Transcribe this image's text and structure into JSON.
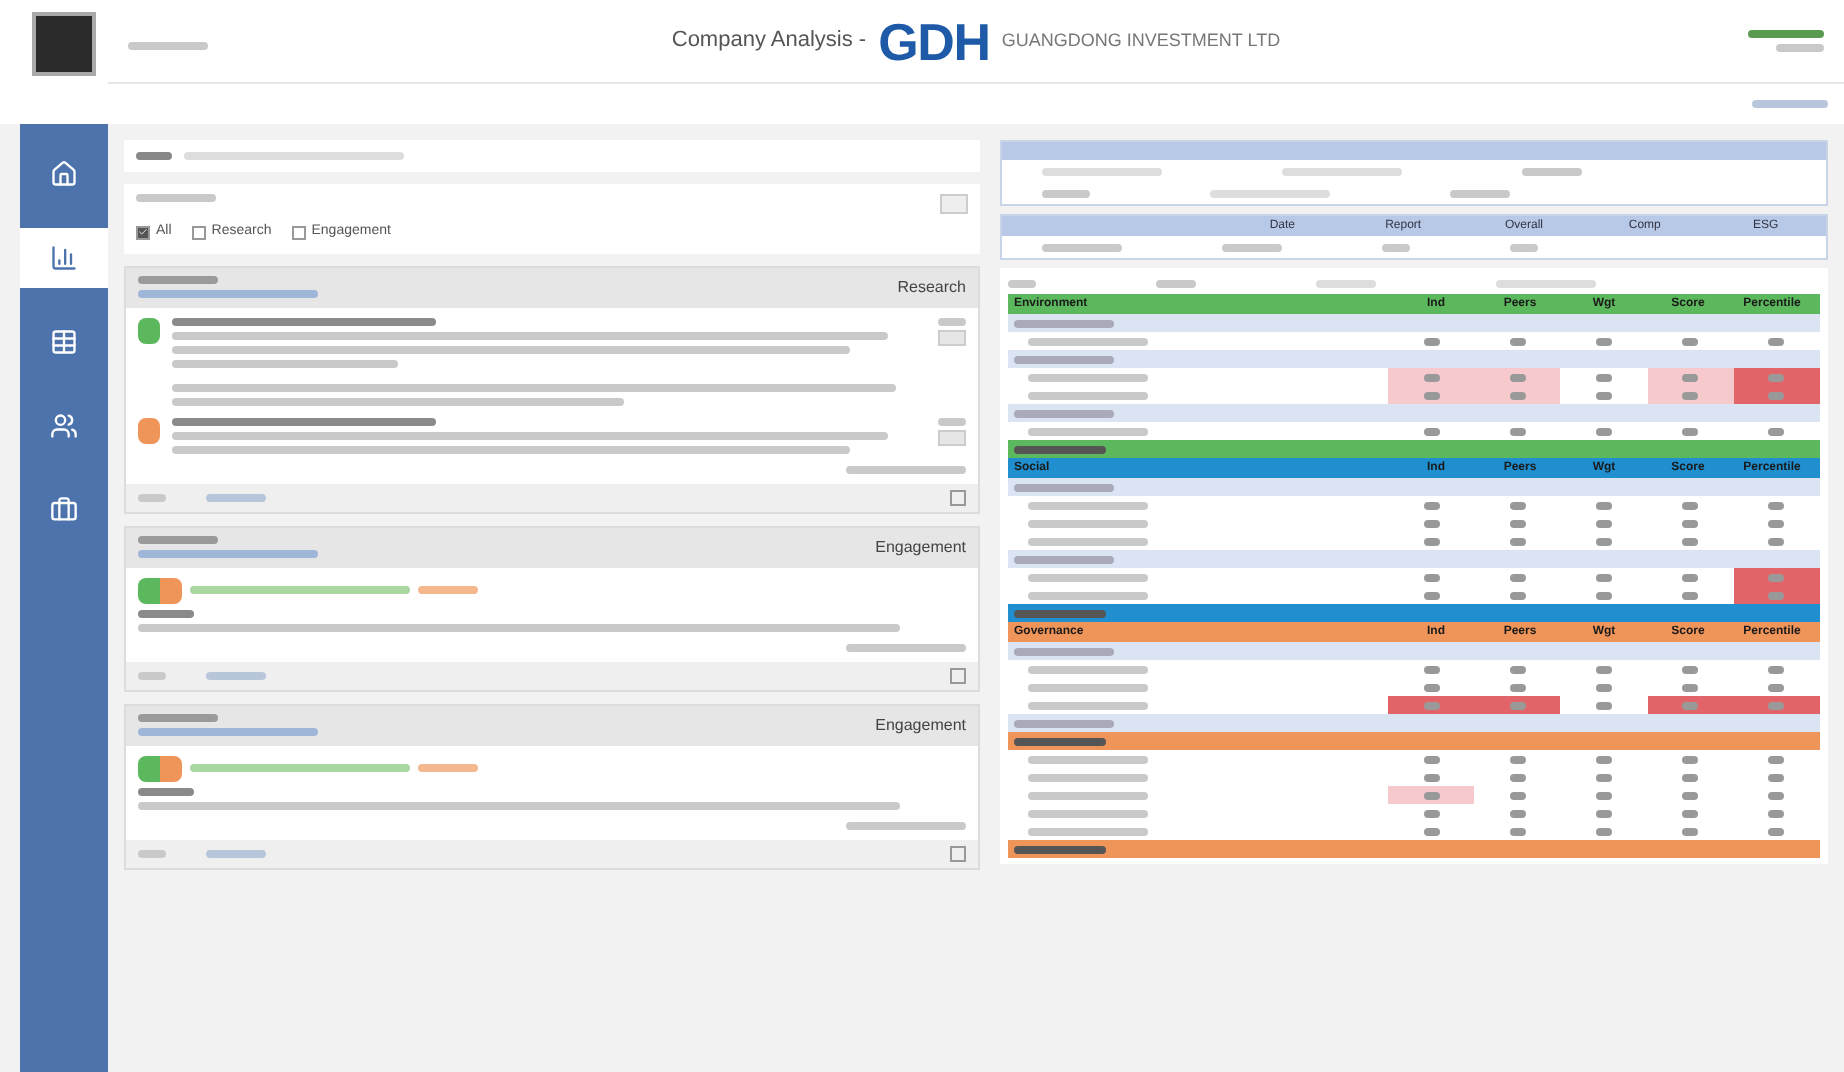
{
  "header": {
    "title": "Company Analysis -",
    "logo": "GDH",
    "company": "GUANGDONG INVESTMENT LTD"
  },
  "sidebar": {
    "items": [
      {
        "kind": "home",
        "selected": false
      },
      {
        "kind": "chart",
        "selected": true
      },
      {
        "kind": "table",
        "selected": false
      },
      {
        "kind": "people",
        "selected": false
      },
      {
        "kind": "briefcase",
        "selected": false
      }
    ]
  },
  "filters": [
    {
      "label": "All",
      "checked": true
    },
    {
      "label": "Research",
      "checked": false
    },
    {
      "label": "Engagement",
      "checked": false
    }
  ],
  "cards": [
    {
      "type": "Research",
      "items": [
        {
          "kind": "note",
          "color": "#5cb85c"
        },
        {
          "kind": "note",
          "color": "#f0955a"
        }
      ]
    },
    {
      "type": "Engagement",
      "items": [
        {
          "kind": "meeting",
          "color": "#5cb85c"
        }
      ]
    },
    {
      "type": "Engagement",
      "items": [
        {
          "kind": "meeting",
          "color": "#5cb85c"
        }
      ]
    }
  ],
  "proxy_table": {
    "columns": [
      "Date",
      "Report",
      "Overall",
      "Comp",
      "ESG"
    ]
  },
  "esg_sections": [
    {
      "title": "Environment",
      "color": "#5cb85c",
      "columns": [
        "Ind",
        "Peers",
        "Wgt",
        "Score",
        "Percentile"
      ],
      "rows": [
        {
          "kind": "group"
        },
        {
          "kind": "item"
        },
        {
          "kind": "group"
        },
        {
          "kind": "item",
          "cells": [
            {
              "kind": "light"
            },
            {
              "kind": "light"
            },
            {
              "kind": "plain"
            },
            {
              "kind": "light"
            },
            {
              "kind": "strong"
            }
          ]
        },
        {
          "kind": "item",
          "cells": [
            {
              "kind": "light"
            },
            {
              "kind": "light"
            },
            {
              "kind": "plain"
            },
            {
              "kind": "light"
            },
            {
              "kind": "strong"
            }
          ]
        },
        {
          "kind": "group"
        },
        {
          "kind": "item"
        },
        {
          "kind": "total"
        }
      ]
    },
    {
      "title": "Social",
      "color": "#1f8fd0",
      "columns": [
        "Ind",
        "Peers",
        "Wgt",
        "Score",
        "Percentile"
      ],
      "rows": [
        {
          "kind": "group"
        },
        {
          "kind": "item"
        },
        {
          "kind": "item"
        },
        {
          "kind": "item"
        },
        {
          "kind": "group"
        },
        {
          "kind": "item",
          "cells": [
            {
              "kind": "plain"
            },
            {
              "kind": "plain"
            },
            {
              "kind": "plain"
            },
            {
              "kind": "plain"
            },
            {
              "kind": "strong"
            }
          ]
        },
        {
          "kind": "item",
          "cells": [
            {
              "kind": "plain"
            },
            {
              "kind": "plain"
            },
            {
              "kind": "plain"
            },
            {
              "kind": "plain"
            },
            {
              "kind": "strong"
            }
          ]
        },
        {
          "kind": "total"
        }
      ]
    },
    {
      "title": "Governance",
      "color": "#f0955a",
      "columns": [
        "Ind",
        "Peers",
        "Wgt",
        "Score",
        "Percentile"
      ],
      "rows": [
        {
          "kind": "group"
        },
        {
          "kind": "item"
        },
        {
          "kind": "item"
        },
        {
          "kind": "item",
          "cells": [
            {
              "kind": "strong"
            },
            {
              "kind": "strong"
            },
            {
              "kind": "plain"
            },
            {
              "kind": "strong"
            },
            {
              "kind": "strong"
            }
          ]
        },
        {
          "kind": "group"
        },
        {
          "kind": "subtotal"
        },
        {
          "kind": "item"
        },
        {
          "kind": "item"
        },
        {
          "kind": "item",
          "cells": [
            {
              "kind": "light"
            },
            {
              "kind": "plain"
            },
            {
              "kind": "plain"
            },
            {
              "kind": "plain"
            },
            {
              "kind": "plain"
            }
          ]
        },
        {
          "kind": "item"
        },
        {
          "kind": "item"
        },
        {
          "kind": "total"
        }
      ]
    }
  ]
}
